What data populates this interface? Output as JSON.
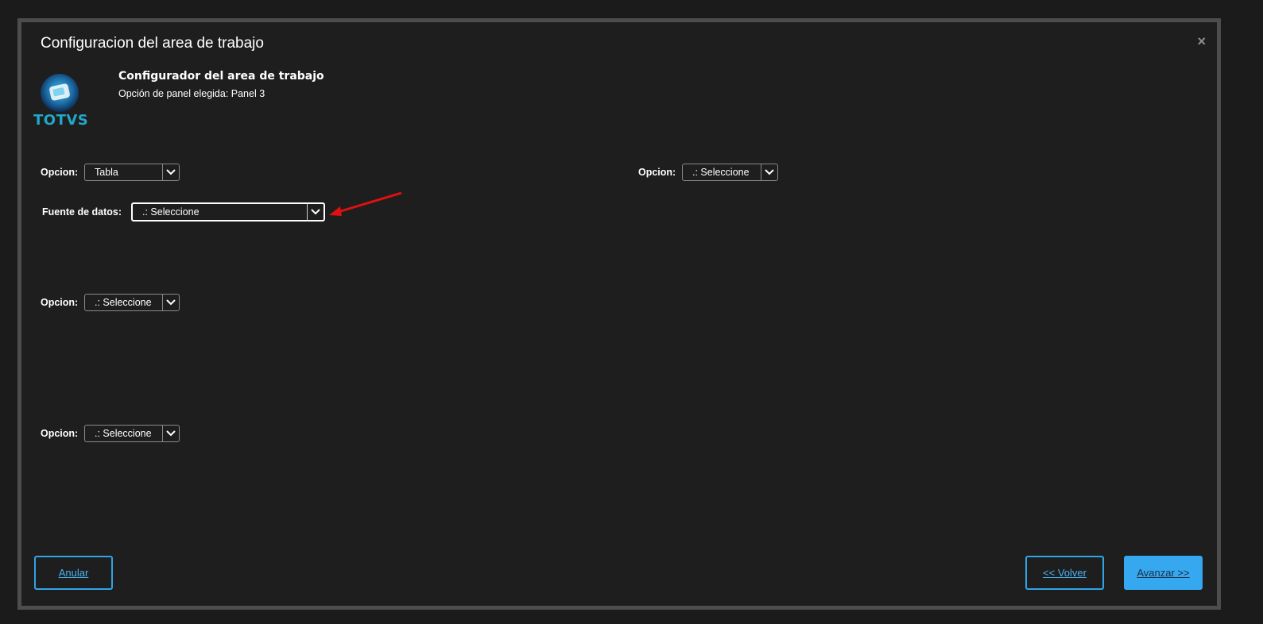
{
  "dialog": {
    "title": "Configuracion del area de trabajo",
    "close_label": "×"
  },
  "logo": {
    "text": "TOTVS"
  },
  "header": {
    "subtitle": "Configurador del area de trabajo",
    "panel_info": "Opción de panel elegida: Panel 3"
  },
  "fields": {
    "opcion1": {
      "label": "Opcion:",
      "value": "Tabla"
    },
    "opcion2": {
      "label": "Opcion:",
      "value": ".: Seleccione"
    },
    "fuente": {
      "label": "Fuente de datos:",
      "value": ".: Seleccione"
    },
    "opcion3": {
      "label": "Opcion:",
      "value": ".: Seleccione"
    },
    "opcion4": {
      "label": "Opcion:",
      "value": ".: Seleccione"
    }
  },
  "buttons": {
    "anular": "Anular",
    "volver": "<< Volver",
    "avanzar": "Avanzar >>"
  },
  "colors": {
    "accent": "#36a8f0",
    "annotation": "#e01010"
  }
}
